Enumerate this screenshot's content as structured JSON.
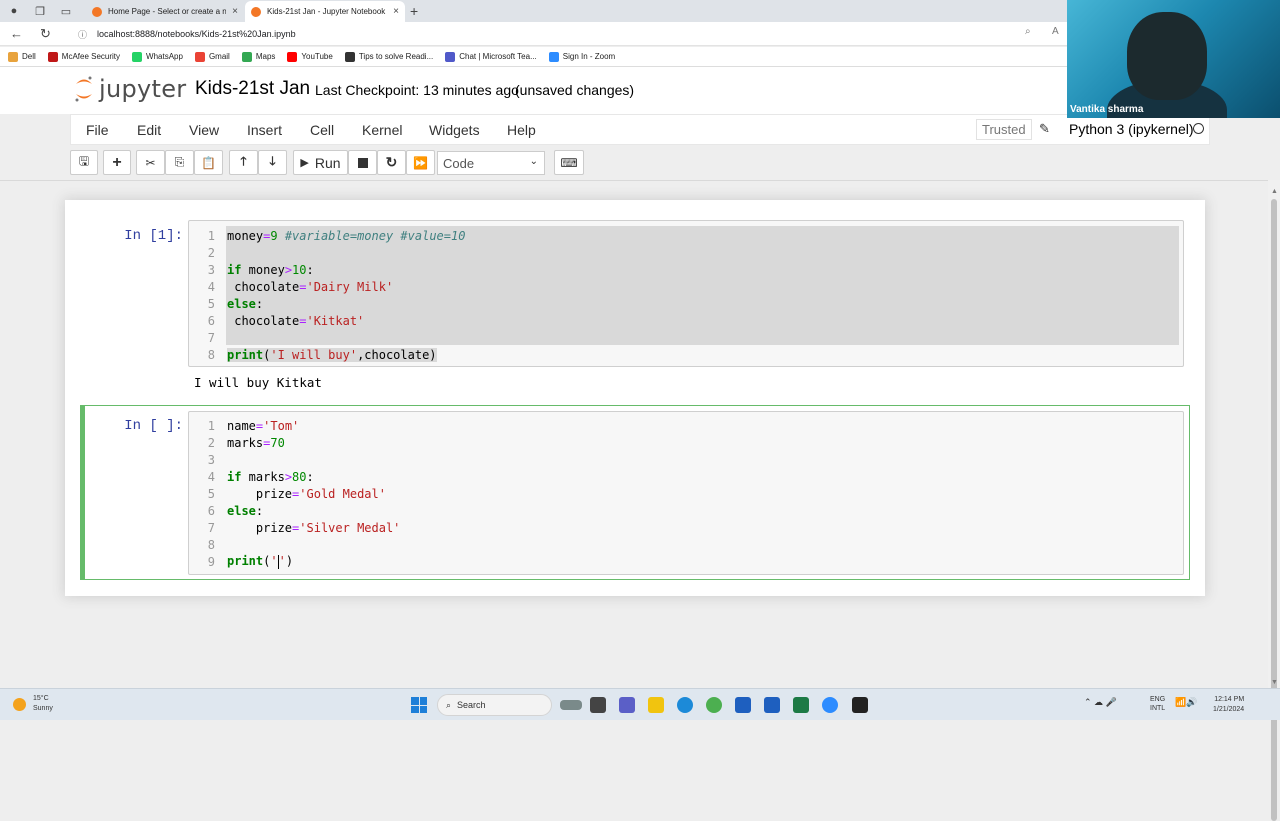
{
  "browser": {
    "tabs": [
      {
        "label": "Home Page - Select or create a n",
        "close": "×"
      },
      {
        "label": "Kids-21st Jan - Jupyter Notebook",
        "close": "×"
      }
    ],
    "new_tab": "+",
    "url": "localhost:8888/notebooks/Kids-21st%20Jan.ipynb",
    "bookmarks": [
      {
        "label": "Dell",
        "color": "#e8a33d"
      },
      {
        "label": "McAfee Security",
        "color": "#c01818"
      },
      {
        "label": "WhatsApp",
        "color": "#25d366"
      },
      {
        "label": "Gmail",
        "color": "#ea4335"
      },
      {
        "label": "Maps",
        "color": "#34a853"
      },
      {
        "label": "YouTube",
        "color": "#ff0000"
      },
      {
        "label": "Tips to solve Readi...",
        "color": "#333333"
      },
      {
        "label": "Chat | Microsoft Tea...",
        "color": "#5059c9"
      },
      {
        "label": "Sign In - Zoom",
        "color": "#2d8cff"
      }
    ]
  },
  "jupyter": {
    "logo_text": "jupyter",
    "notebook_title": "Kids-21st Jan",
    "checkpoint": "Last Checkpoint: 13 minutes ago",
    "unsaved": "(unsaved changes)",
    "menu": [
      "File",
      "Edit",
      "View",
      "Insert",
      "Cell",
      "Kernel",
      "Widgets",
      "Help"
    ],
    "trusted": "Trusted",
    "kernel": "Python 3 (ipykernel)",
    "toolbar": {
      "run_label": "Run",
      "cell_type": "Code",
      "icons": [
        "save-icon",
        "plus-icon",
        "cut-icon",
        "copy-icon",
        "paste-icon",
        "move-up-icon",
        "move-down-icon",
        "run-icon",
        "stop-icon",
        "restart-icon",
        "fast-forward-icon",
        "keyboard-icon"
      ]
    }
  },
  "cells": [
    {
      "prompt": "In [1]:",
      "line_numbers": [
        "1",
        "2",
        "3",
        "4",
        "5",
        "6",
        "7",
        "8"
      ],
      "output": "I will buy Kitkat"
    },
    {
      "prompt": "In [ ]:",
      "line_numbers": [
        "1",
        "2",
        "3",
        "4",
        "5",
        "6",
        "7",
        "8",
        "9"
      ]
    }
  ],
  "webcam": {
    "name": "Vantika sharma"
  },
  "taskbar": {
    "weather_temp": "15°C",
    "weather_desc": "Sunny",
    "search_label": "Search",
    "lang1": "ENG",
    "lang2": "INTL",
    "time": "12:14 PM",
    "date": "1/21/2024"
  }
}
